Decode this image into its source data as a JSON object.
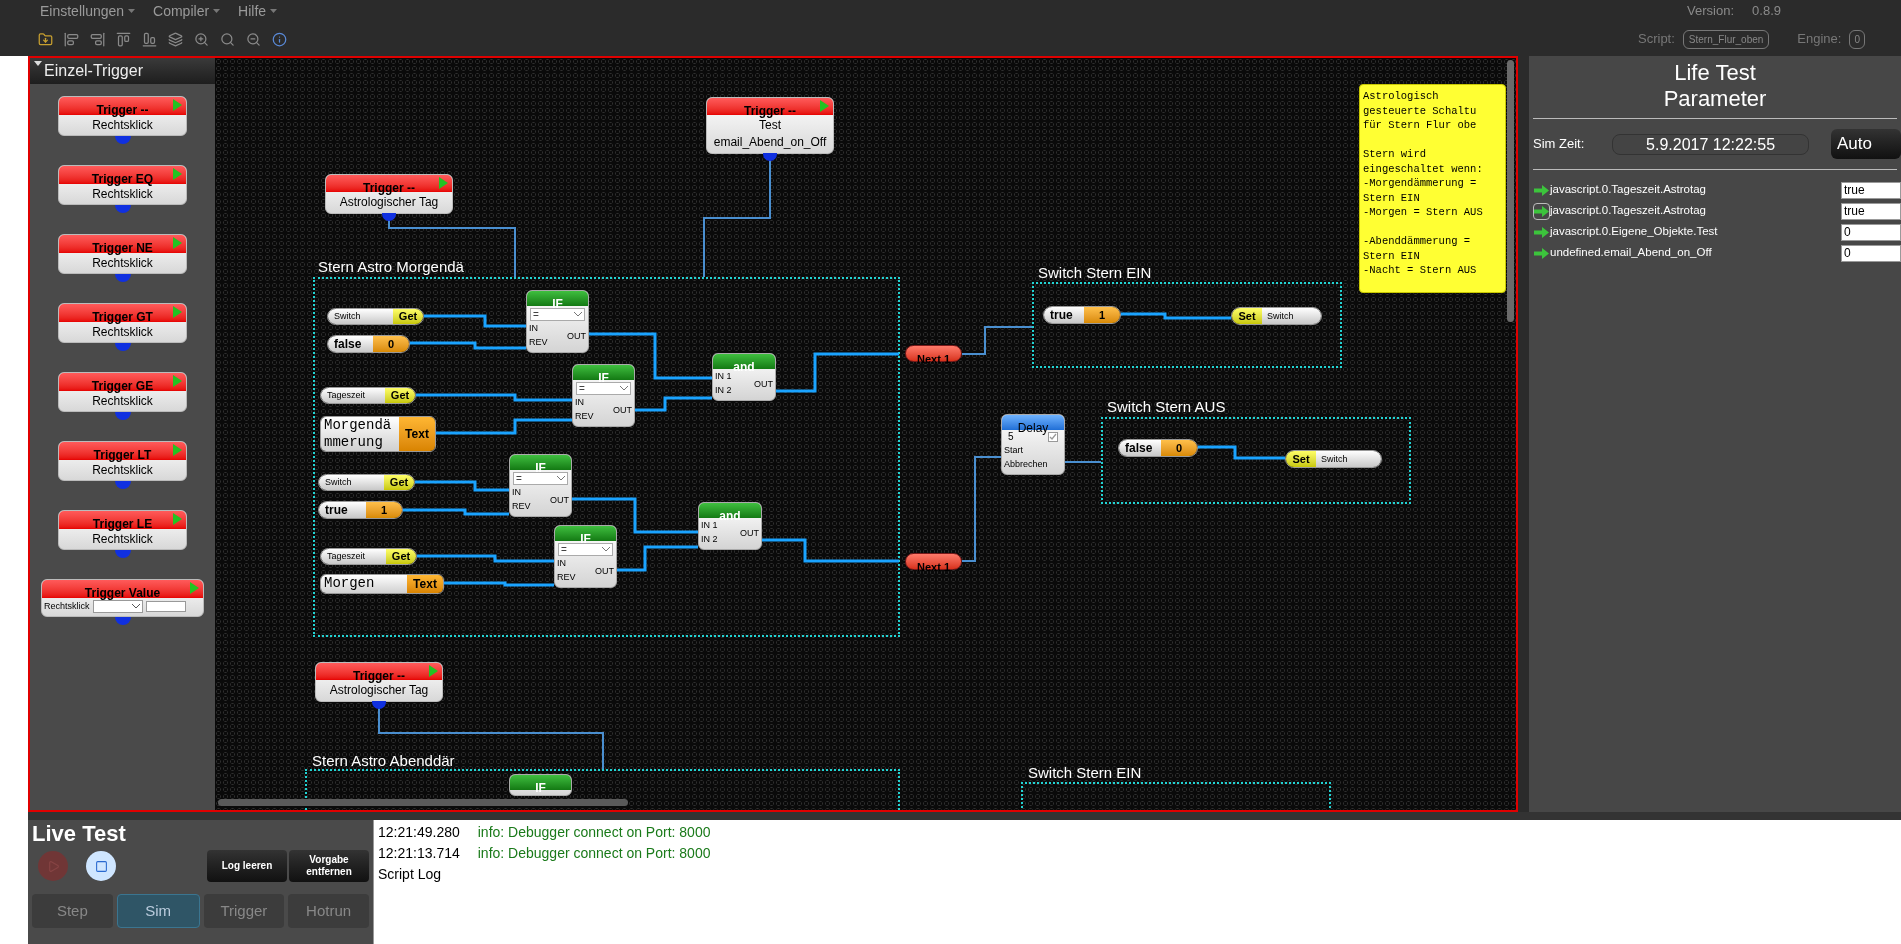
{
  "menu": [
    {
      "label": "Einstellungen"
    },
    {
      "label": "Compiler"
    },
    {
      "label": "Hilfe"
    }
  ],
  "version_label": "Version:",
  "version": "0.8.9",
  "script_label": "Script:",
  "script_name": "Stern_Flur_oben",
  "engine_label": "Engine:",
  "engine_value": "0",
  "palette": {
    "title": "Einzel-Trigger",
    "blocks": [
      {
        "kind": "trigger",
        "title": "Trigger --",
        "subtitle": "Rechtsklick"
      },
      {
        "kind": "trigger",
        "title": "Trigger EQ",
        "subtitle": "Rechtsklick"
      },
      {
        "kind": "trigger",
        "title": "Trigger NE",
        "subtitle": "Rechtsklick"
      },
      {
        "kind": "trigger",
        "title": "Trigger GT",
        "subtitle": "Rechtsklick"
      },
      {
        "kind": "trigger",
        "title": "Trigger GE",
        "subtitle": "Rechtsklick"
      },
      {
        "kind": "trigger",
        "title": "Trigger LT",
        "subtitle": "Rechtsklick"
      },
      {
        "kind": "trigger",
        "title": "Trigger LE",
        "subtitle": "Rechtsklick"
      },
      {
        "kind": "value",
        "title": "Trigger Value",
        "subtitle": "Rechtsklick"
      }
    ]
  },
  "canvas": {
    "groups": [
      {
        "title": "Stern Astro Morgendä"
      },
      {
        "title": "Switch Stern EIN"
      },
      {
        "title": "Switch Stern AUS"
      },
      {
        "title": "Stern Astro Abenddär"
      },
      {
        "title": "Switch Stern EIN"
      }
    ],
    "nodes": [
      {
        "kind": "trigger",
        "title": "Trigger --",
        "lines": [
          "Test",
          "email_Abend_on_Off"
        ]
      },
      {
        "kind": "trigger",
        "title": "Trigger --",
        "lines": [
          "Astrologischer Tag"
        ]
      },
      {
        "kind": "get",
        "label": "Switch",
        "action": "Get"
      },
      {
        "kind": "const",
        "value": "false",
        "number": "0"
      },
      {
        "kind": "if",
        "title": "IF",
        "operator": "=",
        "inputs": [
          "IN",
          "REV"
        ],
        "output": "OUT"
      },
      {
        "kind": "get",
        "label": "Tageszeit",
        "action": "Get"
      },
      {
        "kind": "text",
        "value": "Morgendämmerung",
        "action": "Text"
      },
      {
        "kind": "if",
        "title": "IF",
        "operator": "=",
        "inputs": [
          "IN",
          "REV"
        ],
        "output": "OUT"
      },
      {
        "kind": "and",
        "title": "and",
        "inputs": [
          "IN 1",
          "IN 2"
        ],
        "output": "OUT"
      },
      {
        "kind": "get",
        "label": "Switch",
        "action": "Get"
      },
      {
        "kind": "const",
        "value": "true",
        "number": "1"
      },
      {
        "kind": "if",
        "title": "IF",
        "operator": "=",
        "inputs": [
          "IN",
          "REV"
        ],
        "output": "OUT"
      },
      {
        "kind": "get",
        "label": "Tageszeit",
        "action": "Get"
      },
      {
        "kind": "text",
        "value": "Morgen",
        "action": "Text"
      },
      {
        "kind": "if",
        "title": "IF",
        "operator": "=",
        "inputs": [
          "IN",
          "REV"
        ],
        "output": "OUT"
      },
      {
        "kind": "and",
        "title": "and",
        "inputs": [
          "IN 1",
          "IN 2"
        ],
        "output": "OUT"
      },
      {
        "kind": "next",
        "label": "Next 1"
      },
      {
        "kind": "next",
        "label": "Next 1"
      },
      {
        "kind": "delay",
        "title": "Delay",
        "value": "5",
        "checked": true,
        "inputs": [
          "Start",
          "Abbrechen"
        ]
      },
      {
        "kind": "const",
        "value": "true",
        "number": "1"
      },
      {
        "kind": "set",
        "action": "Set",
        "label": "Switch"
      },
      {
        "kind": "const",
        "value": "false",
        "number": "0"
      },
      {
        "kind": "set",
        "action": "Set",
        "label": "Switch"
      },
      {
        "kind": "trigger",
        "title": "Trigger --",
        "lines": [
          "Astrologischer Tag"
        ]
      },
      {
        "kind": "if",
        "title": "IF"
      }
    ],
    "note": {
      "text": "Astrologisch\ngesteuerte Schaltu\nfür Stern Flur obe\n\nStern wird\neingeschaltet wenn:\n-Morgendämmerung =\nStern EIN\n-Morgen = Stern AUS\n\n-Abenddämmerung =\nStern EIN\n-Nacht = Stern AUS"
    }
  },
  "sidebar": {
    "title_lines": [
      "Life Test",
      "Parameter"
    ],
    "sim_label": "Sim Zeit:",
    "sim_time": "5.9.2017 12:22:55",
    "auto_button": "Auto",
    "params": [
      {
        "name": "javascript.0.Tageszeit.Astrotag",
        "value": "true",
        "selected": false
      },
      {
        "name": "javascript.0.Tageszeit.Astrotag",
        "value": "true",
        "selected": true
      },
      {
        "name": "javascript.0.Eigene_Objekte.Test",
        "value": "0",
        "selected": false
      },
      {
        "name": "undefined.email_Abend_on_Off",
        "value": "0",
        "selected": false
      }
    ]
  },
  "live_test": {
    "title": "Live Test",
    "controls": [
      {
        "kind": "play",
        "disabled": true
      },
      {
        "kind": "stop",
        "disabled": false
      }
    ],
    "buttons": [
      "Log leeren",
      "Vorgabe entfernen"
    ],
    "modes": [
      {
        "label": "Step",
        "selected": false
      },
      {
        "label": "Sim",
        "selected": true
      },
      {
        "label": "Trigger",
        "selected": false
      },
      {
        "label": "Hotrun",
        "selected": false
      }
    ]
  },
  "log": {
    "entries": [
      {
        "time": "12:21:49.280",
        "message": "info: Debugger connect on Port: 8000"
      },
      {
        "time": "12:21:13.714",
        "message": "info: Debugger connect on Port: 8000"
      }
    ],
    "footer": "Script Log"
  }
}
